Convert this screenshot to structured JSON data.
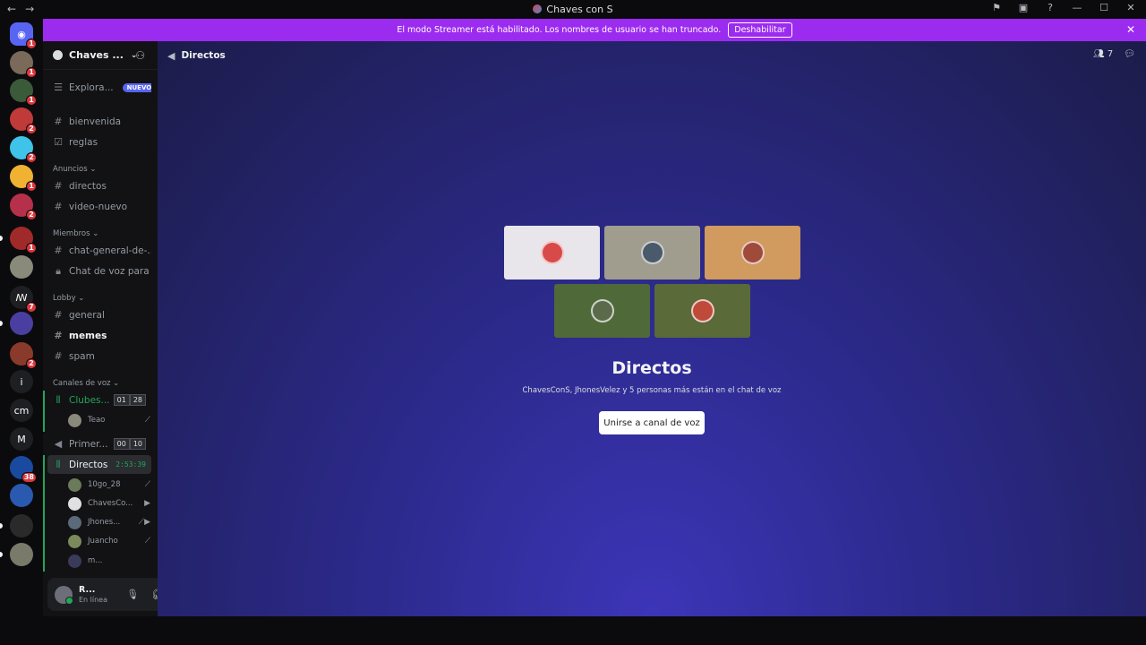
{
  "window": {
    "title": "Chaves con S",
    "nav_back": "←",
    "nav_forward": "→",
    "controls": [
      "⚑",
      "▣",
      "?",
      "—",
      "☐",
      "✕"
    ]
  },
  "banner": {
    "text": "El modo Streamer está habilitado. Los nombres de usuario se han truncado.",
    "button": "Deshabilitar",
    "close": "✕"
  },
  "guilds": [
    {
      "icon": "discord-icon",
      "badge": "1",
      "color": "#5865f2"
    },
    {
      "badge": "1",
      "color": "#7a6a5a"
    },
    {
      "badge": "1",
      "color": "#3a5a3a"
    },
    {
      "badge": "2",
      "color": "#c03a3a"
    },
    {
      "badge": "2",
      "color": "#3fc3e8"
    },
    {
      "badge": "1",
      "color": "#f0b232"
    },
    {
      "badge": "2",
      "color": "#b5304a"
    },
    {
      "badge": "1",
      "color": "#a02a2a"
    },
    {
      "badge": "",
      "color": "#8a8a7a"
    },
    {
      "badge": "7",
      "color": "#1e1f22",
      "label": "ꟿ"
    },
    {
      "badge": "",
      "color": "#4a3fa0"
    },
    {
      "badge": "2",
      "color": "#8a3a2a"
    },
    {
      "badge": "",
      "color": "#1e1f22",
      "label": "i"
    },
    {
      "badge": "",
      "color": "#1e1f22",
      "label": "cm"
    },
    {
      "badge": "",
      "color": "#1e1f22",
      "label": "M"
    },
    {
      "badge": "38",
      "color": "#1a4aa0"
    },
    {
      "badge": "",
      "color": "#2a5ab0"
    },
    {
      "badge": "",
      "color": "#2a2a2a"
    },
    {
      "badge": "",
      "color": "#7a7a6a"
    }
  ],
  "server": {
    "name": "Chaves ...",
    "explore": "Explora...",
    "explore_badge": "NUEVO",
    "channels_top": [
      "bienvenida",
      "reglas"
    ],
    "categories": {
      "anuncios": "Anuncios",
      "miembros": "Miembros",
      "lobby": "Lobby",
      "voz": "Canales de voz"
    },
    "anuncios": [
      "directos",
      "video-nuevo"
    ],
    "miembros": [
      "chat-general-de-...",
      "Chat de voz para ..."
    ],
    "lobby": [
      "general",
      "memes",
      "spam"
    ],
    "voice": {
      "clubes": {
        "name": "Clubes...",
        "count_a": "01",
        "count_b": "28"
      },
      "clubes_user": "Teao",
      "primer": {
        "name": "Primer...",
        "count_a": "00",
        "count_b": "10"
      },
      "directos": {
        "name": "Directos",
        "timer": "2:53:39"
      },
      "directos_users": [
        "10go_28",
        "ChavesCo...",
        "Jhones...",
        "Juancho",
        "m..."
      ]
    }
  },
  "user": {
    "name": "R...",
    "status": "En línea"
  },
  "main": {
    "channel": "Directos",
    "member_count": "7",
    "title": "Directos",
    "subtitle": "ChavesConS, JhonesVelez y 5 personas más están en el chat de voz",
    "join_button": "Unirse a canal de voz",
    "tiles": [
      {
        "bg": "#e8e6ea",
        "av": "#d84a4a"
      },
      {
        "bg": "#a19d8e",
        "av": "#4a5a6a"
      },
      {
        "bg": "#d19a5e",
        "av": "#a04a3a"
      },
      {
        "bg": "#4f6a38",
        "av": "#5a6a4a"
      },
      {
        "bg": "#5a6a38",
        "av": "#c04a3a"
      }
    ]
  }
}
